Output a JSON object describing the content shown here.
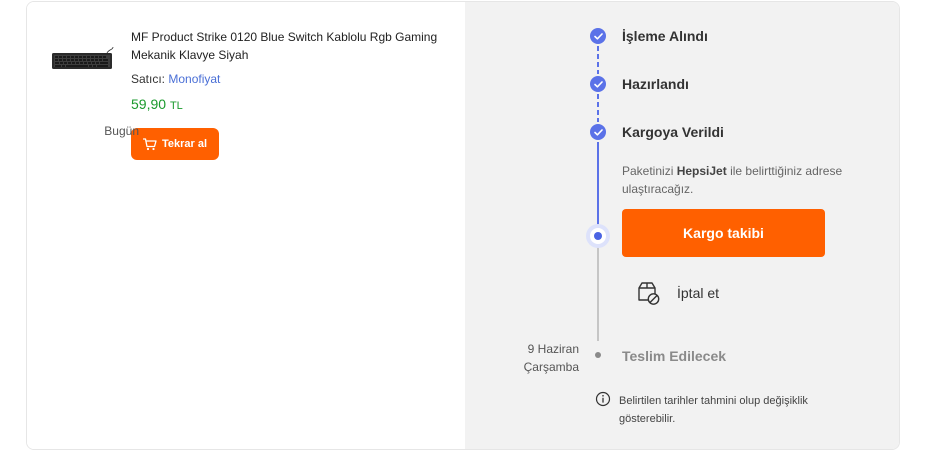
{
  "product": {
    "title": "MF Product Strike 0120 Blue Switch Kablolu Rgb Gaming Mekanik Klavye Siyah",
    "seller_prefix": "Satıcı:",
    "seller_name": "Monofiyat",
    "price_amount": "59,90",
    "price_currency": "TL",
    "reorder_label": "Tekrar al"
  },
  "tracking": {
    "steps": [
      {
        "label": "İşleme Alındı",
        "date": ""
      },
      {
        "label": "Hazırlandı",
        "date": ""
      },
      {
        "label": "Kargoya Verildi",
        "date": "Bugün"
      }
    ],
    "info_prefix": "Paketinizi ",
    "carrier": "HepsiJet",
    "info_suffix": " ile belirttiğiniz adrese ulaştıracağız.",
    "track_button": "Kargo takibi",
    "cancel_label": "İptal et",
    "delivery": {
      "date_line1": "9 Haziran",
      "date_line2": "Çarşamba",
      "label": "Teslim Edilecek"
    },
    "note": "Belirtilen tarihler tahmini olup değişiklik gösterebilir."
  },
  "colors": {
    "accent": "#ff6000",
    "step_blue": "#5b72e8",
    "price_green": "#1a9a2c",
    "seller_link": "#4a6fd6"
  }
}
